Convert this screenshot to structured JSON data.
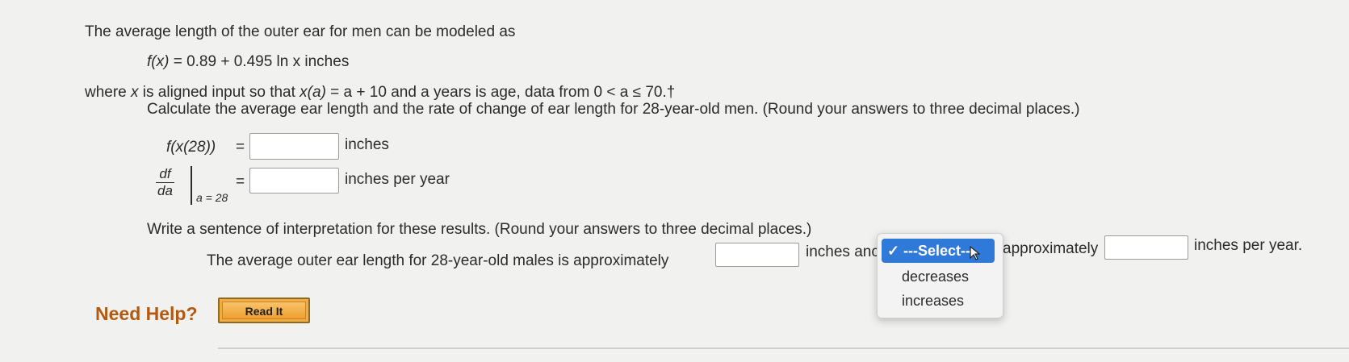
{
  "problem": {
    "intro": "The average length of the outer ear for men can be modeled as",
    "formula_lhs": "f(x)",
    "formula_rhs": " = 0.89 + 0.495 ln x inches",
    "where_part1": "where ",
    "where_x": "x",
    "where_part2": " is aligned input so that  ",
    "where_xa": "x(a)",
    "where_part3": " = a + 10  and a years is age, data from 0 < a ≤ 70.†"
  },
  "instruction": "Calculate the average ear length and the rate of change of ear length for 28-year-old men. (Round your answers to three decimal places.)",
  "answer1": {
    "label": "f(x(28))",
    "equals": "=",
    "unit": "inches",
    "value": ""
  },
  "answer2": {
    "num": "df",
    "den": "da",
    "sub": "a = 28",
    "equals": "=",
    "unit": "inches per year",
    "value": ""
  },
  "interpretation": {
    "instruction": "Write a sentence of interpretation for these results. (Round your answers to three decimal places.)",
    "sentence_start": "The average outer ear length for 28-year-old males is approximately",
    "after_box1": "inches anc",
    "after_select": "approximately",
    "after_box2": "inches per year.",
    "value1": "",
    "value2": ""
  },
  "dropdown": {
    "selected": "---Select---",
    "options": [
      "decreases",
      "increases"
    ],
    "highlight_color": "#2f7ad9"
  },
  "help": {
    "label": "Need Help?",
    "read_it": "Read It"
  },
  "colors": {
    "help": "#b25a12",
    "button": "#f4ac3d"
  }
}
